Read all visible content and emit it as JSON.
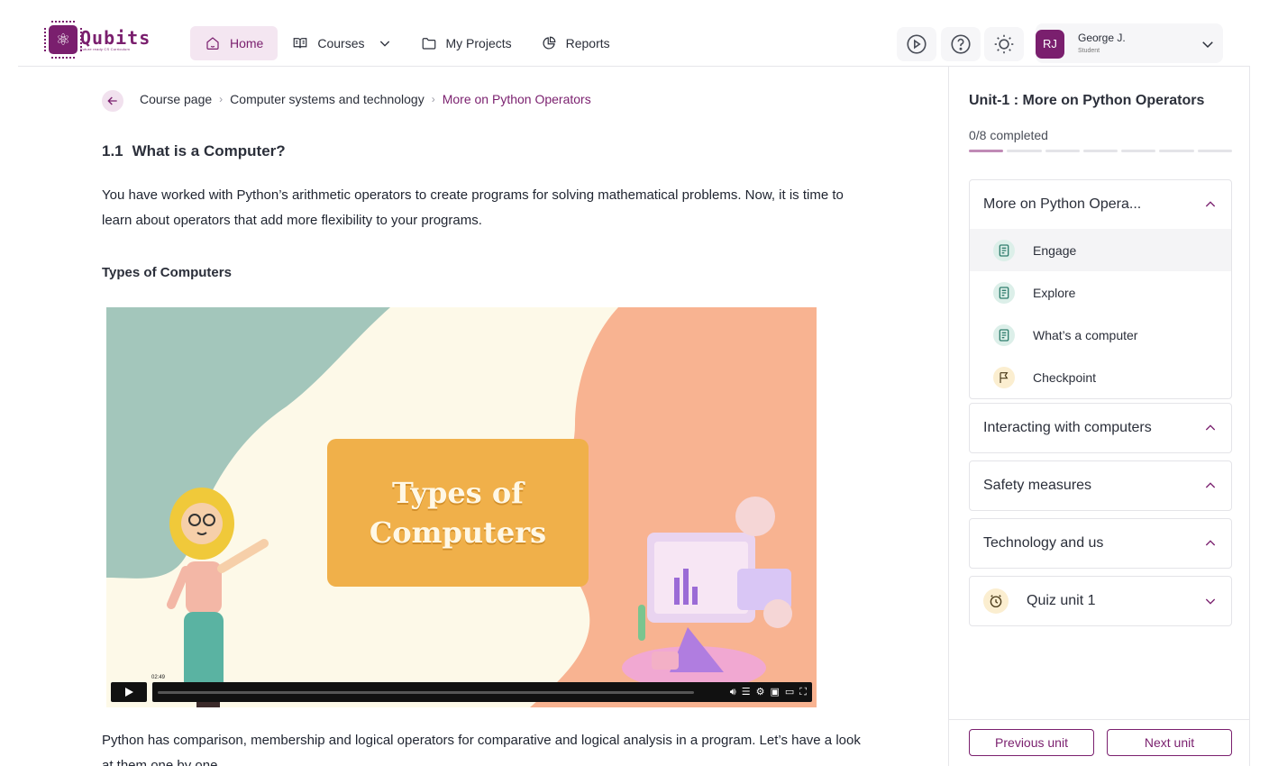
{
  "brand": {
    "name": "Qubits",
    "tagline": "Future ready CS Curriculum",
    "color": "#7a1f6e"
  },
  "nav": {
    "home": "Home",
    "courses": "Courses",
    "projects": "My Projects",
    "reports": "Reports"
  },
  "user": {
    "initials": "RJ",
    "name": "George J.",
    "role": "Student"
  },
  "breadcrumb": {
    "items": [
      "Course page",
      "Computer systems and technology"
    ],
    "current": "More on Python Operators"
  },
  "content": {
    "section_number": "1.1",
    "section_title": "What is a Computer?",
    "intro": "You have worked with Python’s arithmetic operators to create programs for solving mathematical problems. Now, it is time to learn about operators that add more flexibility to your programs.",
    "subheading": "Types of Computers",
    "video": {
      "title_line1": "Types of",
      "title_line2": "Computers",
      "time": "02:49"
    },
    "outro": "Python has comparison, membership and logical operators for comparative and logical analysis in a program. Let’s have a look at them one by one."
  },
  "sidebar": {
    "unit_title": "Unit-1 : More on Python Operators",
    "progress_text": "0/8 completed",
    "progress": {
      "completed": 1,
      "total": 7
    },
    "sections": [
      {
        "title": "More on Python Opera...",
        "lessons": [
          {
            "label": "Engage",
            "icon": "book-icon"
          },
          {
            "label": "Explore",
            "icon": "book-icon"
          },
          {
            "label": "What’s a computer",
            "icon": "book-icon"
          },
          {
            "label": "Checkpoint",
            "icon": "flag-icon"
          }
        ]
      },
      {
        "title": "Interacting with computers"
      },
      {
        "title": "Safety measures"
      },
      {
        "title": "Technology and us"
      },
      {
        "title": "Quiz unit 1"
      }
    ],
    "prev_label": "Previous unit",
    "next_label": "Next unit"
  }
}
